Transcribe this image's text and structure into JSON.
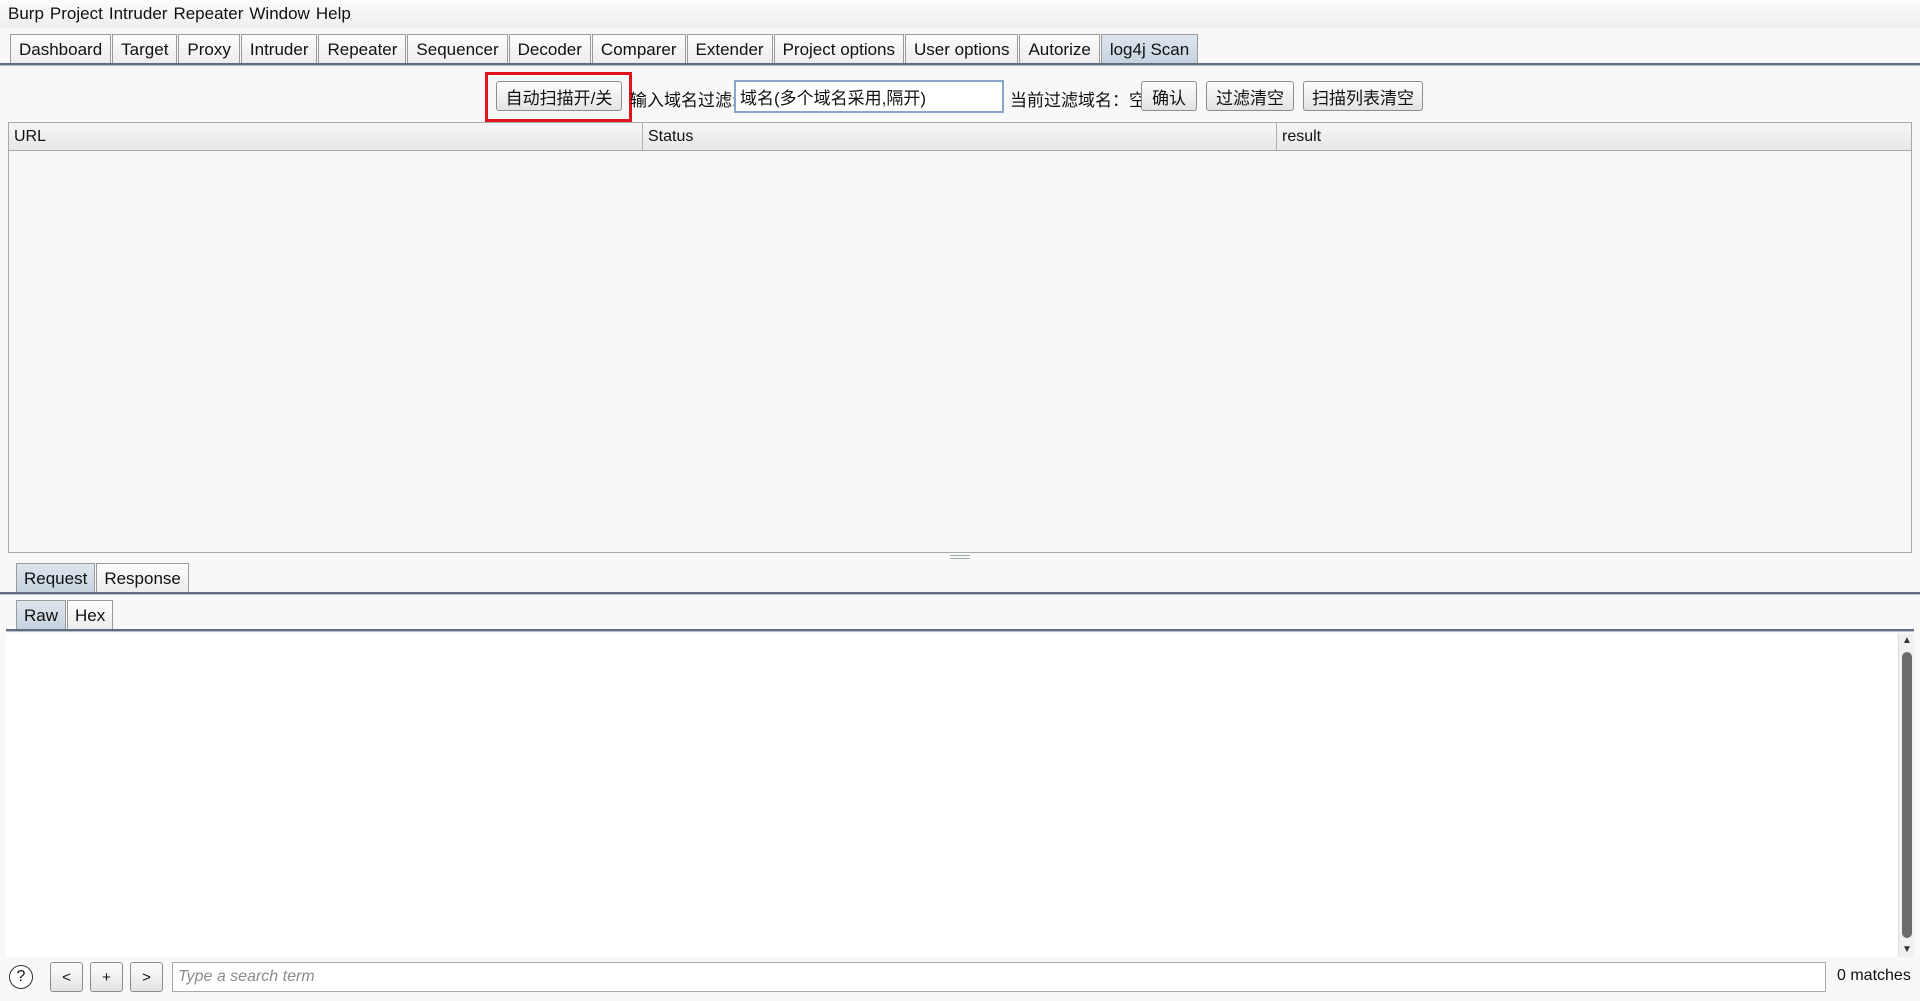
{
  "menu": [
    "Burp",
    "Project",
    "Intruder",
    "Repeater",
    "Window",
    "Help"
  ],
  "tabs": [
    "Dashboard",
    "Target",
    "Proxy",
    "Intruder",
    "Repeater",
    "Sequencer",
    "Decoder",
    "Comparer",
    "Extender",
    "Project options",
    "User options",
    "Autorize",
    "log4j Scan"
  ],
  "active_tab": "log4j Scan",
  "toolbar": {
    "auto_scan_label": "自动扫描开/关",
    "filter_label": "输入域名过滤:",
    "filter_value": "域名(多个域名采用,隔开)",
    "current_filter_label": "当前过滤域名：空",
    "confirm_label": "确认",
    "clear_filter_label": "过滤清空",
    "clear_list_label": "扫描列表清空"
  },
  "table": {
    "columns": [
      "URL",
      "Status",
      "result"
    ],
    "rows": []
  },
  "detail_tabs": [
    "Request",
    "Response"
  ],
  "view_tabs": [
    "Raw",
    "Hex"
  ],
  "bottom": {
    "help": "?",
    "prev": "<",
    "add": "+",
    "next": ">",
    "search_placeholder": "Type a search term",
    "matches": "0 matches"
  },
  "colors": {
    "highlight_border": "#e0141e",
    "active_tab": "#c4d2de"
  }
}
